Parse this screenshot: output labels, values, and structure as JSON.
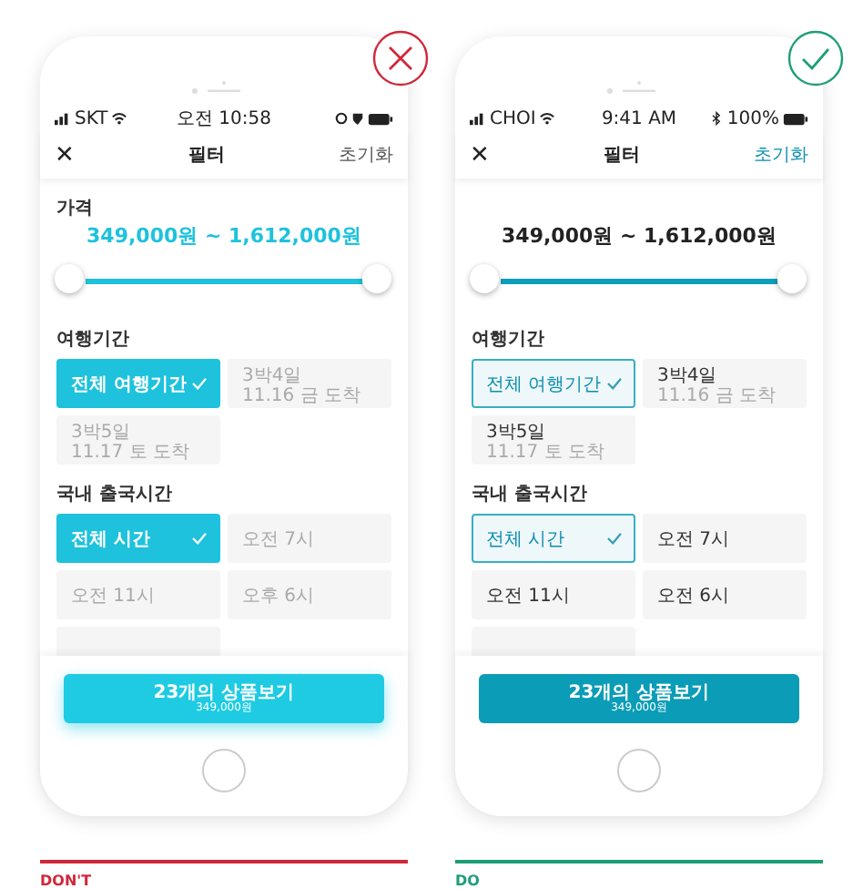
{
  "panels": [
    {
      "kind": "dont",
      "caption": "DON'T",
      "color": "#d0283a",
      "status": {
        "carrier": "SKT",
        "time": "오전 10:58"
      },
      "nav": {
        "close": "✕",
        "title": "필터",
        "reset": "초기화"
      },
      "price": {
        "label": "가격",
        "range": "349,000원 ~ 1,612,000원",
        "level": 1
      },
      "sections": [
        {
          "title": "여행기간",
          "options": [
            {
              "label": "전체 여행기간",
              "selected": true
            },
            {
              "label": "3박4일",
              "sub": "11.16 금 도착",
              "selected": false
            },
            {
              "label": "3박5일",
              "sub": "11.17 토 도착",
              "selected": false
            }
          ]
        },
        {
          "title": "국내 출국시간",
          "options": [
            {
              "label": "전체 시간",
              "selected": true
            },
            {
              "label": "오전 7시",
              "selected": false
            },
            {
              "label": "오전 11시",
              "selected": false
            },
            {
              "label": "오후 6시",
              "selected": false
            },
            {
              "selected": false
            }
          ]
        }
      ],
      "cta": {
        "label": "23개의 상품보기",
        "sub": "349,000원"
      }
    },
    {
      "kind": "do",
      "caption": "DO",
      "color": "#1e9e78",
      "status": {
        "carrier": "CHOI",
        "time": "9:41 AM",
        "battery_text": "100%"
      },
      "nav": {
        "close": "✕",
        "title": "필터",
        "reset": "초기화"
      },
      "price": {
        "range": "349,000원 ~ 1,612,000원",
        "level": 1
      },
      "sections": [
        {
          "title": "여행기간",
          "options": [
            {
              "label": "전체 여행기간",
              "selected": true
            },
            {
              "label": "3박4일",
              "sub": "11.16 금 도착",
              "selected": false
            },
            {
              "label": "3박5일",
              "sub": "11.17 토 도착",
              "selected": false
            }
          ]
        },
        {
          "title": "국내 출국시간",
          "options": [
            {
              "label": "전체 시간",
              "selected": true
            },
            {
              "label": "오전 7시",
              "selected": false
            },
            {
              "label": "오전 11시",
              "selected": false
            },
            {
              "label": "오전 6시",
              "selected": false
            },
            {
              "selected": false
            }
          ]
        }
      ],
      "cta": {
        "label": "23개의 상품보기",
        "sub": "349,000원"
      }
    }
  ]
}
